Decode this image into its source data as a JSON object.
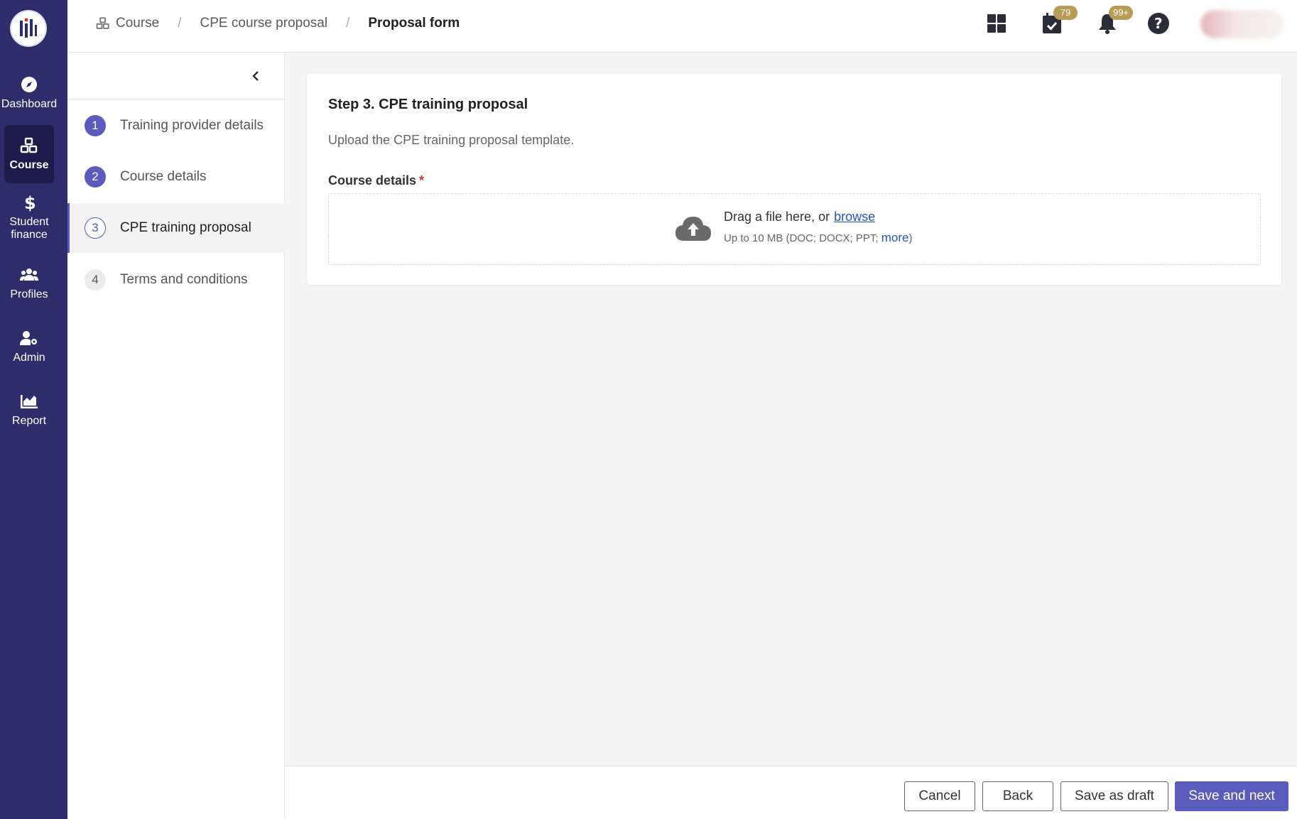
{
  "nav": {
    "items": [
      {
        "label": "Dashboard",
        "icon": "compass-icon"
      },
      {
        "label": "Course",
        "icon": "cubes-icon",
        "active": true
      },
      {
        "label": "Student finance",
        "icon": "dollar-icon"
      },
      {
        "label": "Profiles",
        "icon": "users-icon"
      },
      {
        "label": "Admin",
        "icon": "user-gear-icon"
      },
      {
        "label": "Report",
        "icon": "area-chart-icon"
      }
    ]
  },
  "header": {
    "breadcrumb": [
      "Course",
      "CPE course proposal",
      "Proposal form"
    ],
    "tasks_badge": "79",
    "notifications_badge": "99+"
  },
  "steps": {
    "items": [
      {
        "number": "1",
        "label": "Training provider details",
        "state": "done"
      },
      {
        "number": "2",
        "label": "Course details",
        "state": "done"
      },
      {
        "number": "3",
        "label": "CPE training proposal",
        "state": "current"
      },
      {
        "number": "4",
        "label": "Terms and conditions",
        "state": "todo"
      }
    ]
  },
  "form": {
    "title": "Step 3. CPE training proposal",
    "description": "Upload the CPE training proposal template.",
    "field_label": "Course details",
    "required_mark": "*",
    "dropzone": {
      "prompt": "Drag a file here, or",
      "browse_label": "browse",
      "limits_prefix": "Up to 10 MB (DOC; DOCX; PPT; ",
      "more_label": "more",
      "limits_suffix": ")"
    }
  },
  "footer": {
    "cancel_label": "Cancel",
    "back_label": "Back",
    "draft_label": "Save as draft",
    "next_label": "Save and next"
  },
  "colors": {
    "rail": "#2e2d6b",
    "accent": "#5b5bbd",
    "badge": "#b89b55",
    "link": "#2456b8"
  }
}
